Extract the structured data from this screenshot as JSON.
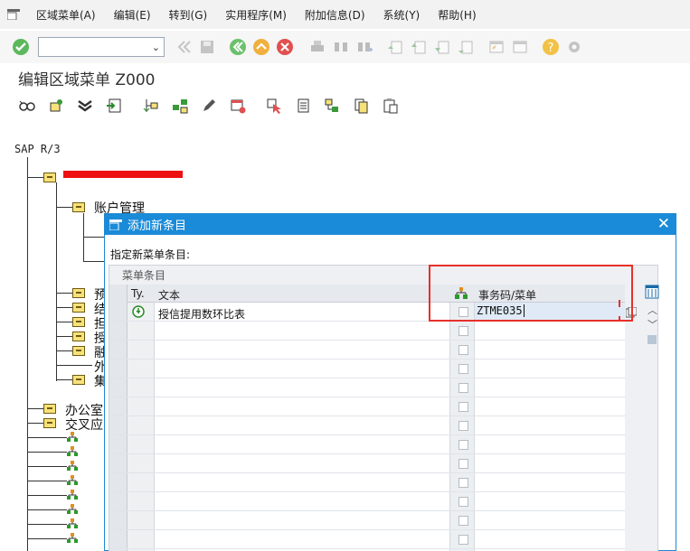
{
  "menubar": {
    "items": [
      "区域菜单(A)",
      "编辑(E)",
      "转到(G)",
      "实用程序(M)",
      "附加信息(D)",
      "系统(Y)",
      "帮助(H)"
    ]
  },
  "toolbar": {
    "command_field_value": "",
    "icons": [
      "enter-icon",
      "back-icon",
      "save-icon",
      "previous-icon",
      "up-icon",
      "cancel-icon",
      "print-icon",
      "find-icon",
      "find-next-icon",
      "first-page-icon",
      "prev-page-icon",
      "next-page-icon",
      "last-page-icon",
      "new-session-icon",
      "shortcut-icon",
      "help-icon",
      "settings-icon"
    ]
  },
  "page": {
    "title": "编辑区域菜单 Z000"
  },
  "toolbar2": {
    "icons": [
      "glasses-icon",
      "add-node-icon",
      "collapse-icon",
      "import-icon",
      "add-same-level-icon",
      "add-sublevel-icon",
      "edit-icon",
      "delete-icon",
      "select-icon",
      "copy-icon",
      "insert-icon",
      "clipboard-icon",
      "paste-icon"
    ]
  },
  "tree": {
    "root": "SAP R/3",
    "level1_first_redacted": "",
    "level2_first": "账户管理",
    "partial_items": [
      "预",
      "结",
      "担",
      "授",
      "融",
      "外",
      "集"
    ],
    "level1_more": [
      "办公室",
      "交叉应"
    ]
  },
  "dialog": {
    "title": "添加新条目",
    "label": "指定新菜单条目:",
    "panel_title": "菜单条目",
    "columns": {
      "type": "Ty.",
      "text": "文本",
      "tcode": "事务码/菜单"
    },
    "rows": [
      {
        "text": "授信提用数环比表",
        "tcode": "ZTME035"
      }
    ],
    "close": "✕"
  },
  "colors": {
    "dialog_title_bg": "#1a8bd8",
    "highlight_red": "#e8302a",
    "folder_yellow": "#f7e27a"
  }
}
